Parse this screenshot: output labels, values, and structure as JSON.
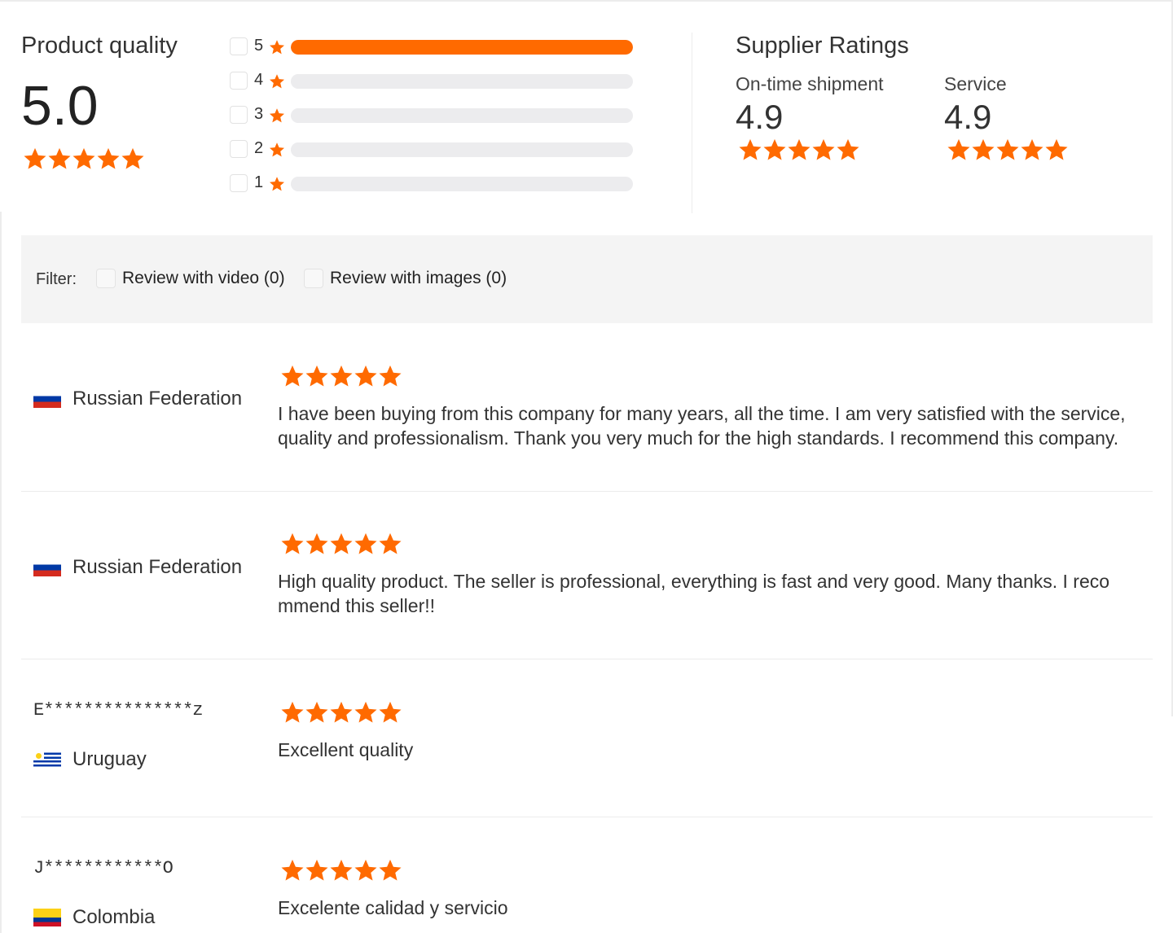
{
  "summary": {
    "product_quality_title": "Product quality",
    "product_quality_score": "5.0",
    "product_quality_stars": 5,
    "distribution": [
      {
        "label": "5",
        "fraction": 1.0
      },
      {
        "label": "4",
        "fraction": 0.0
      },
      {
        "label": "3",
        "fraction": 0.0
      },
      {
        "label": "2",
        "fraction": 0.0
      },
      {
        "label": "1",
        "fraction": 0.0
      }
    ],
    "supplier_title": "Supplier Ratings",
    "supplier_ratings": [
      {
        "label": "On-time shipment",
        "score": "4.9",
        "stars": 5
      },
      {
        "label": "Service",
        "score": "4.9",
        "stars": 5
      }
    ]
  },
  "filter": {
    "label": "Filter:",
    "options": [
      "Review with video (0)",
      "Review with images (0)"
    ]
  },
  "reviews": [
    {
      "user": "",
      "country": "Russian Federation",
      "flag": "ru-flag-icon",
      "stars": 5,
      "text": "I have been buying from this company for many years, all the time. I am very satisfied with the service, quality and professionalism. Thank you very much for the high standards. I recommend this company."
    },
    {
      "user": "",
      "country": "Russian Federation",
      "flag": "ru-flag-icon",
      "stars": 5,
      "text": "High quality product. The seller is professional, everything is fast and very good. Many thanks. I reco mmend this seller!!"
    },
    {
      "user": "E***************z",
      "country": "Uruguay",
      "flag": "uy-flag-icon",
      "stars": 5,
      "text": "Excellent quality"
    },
    {
      "user": "J************O",
      "country": "Colombia",
      "flag": "co-flag-icon",
      "stars": 5,
      "text": "Excelente calidad y servicio"
    }
  ],
  "colors": {
    "accent": "#ff6a00",
    "track": "#ececee",
    "filter_bg": "#f4f4f4"
  }
}
